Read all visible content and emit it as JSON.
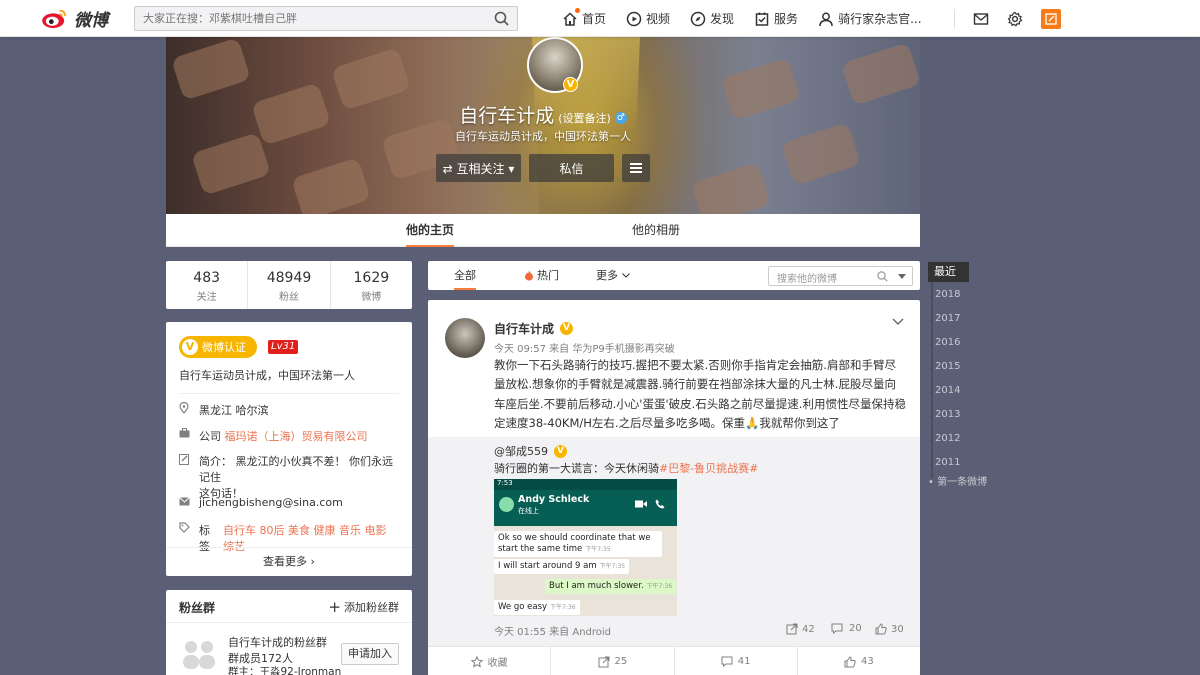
{
  "topbar": {
    "logo_text": "微博",
    "search_placeholder": "大家正在搜：邓紫棋吐槽自己胖",
    "nav": [
      {
        "label": "首页",
        "icon": "home-icon"
      },
      {
        "label": "视频",
        "icon": "video-icon"
      },
      {
        "label": "发现",
        "icon": "discover-icon"
      },
      {
        "label": "服务",
        "icon": "service-icon"
      },
      {
        "label": "骑行家杂志官...",
        "icon": "user-icon"
      }
    ],
    "right_icons": [
      "mail-icon",
      "gear-icon",
      "compose-icon"
    ]
  },
  "profile": {
    "name": "自行车计成",
    "remark": "(设置备注)",
    "gender": "♂",
    "description": "自行车运动员计成，中国环法第一人",
    "follow_button": "⇄ 互相关注 ▾",
    "message_button": "私信",
    "tabs": [
      "他的主页",
      "他的相册"
    ]
  },
  "stats": [
    {
      "num": "483",
      "label": "关注"
    },
    {
      "num": "48949",
      "label": "粉丝"
    },
    {
      "num": "1629",
      "label": "微博"
    }
  ],
  "info": {
    "verify_label": "微博认证",
    "level": "Lv31",
    "desc": "自行车运动员计成，中国环法第一人",
    "location": "黑龙江 哈尔滨",
    "company_prefix": "公司",
    "company": "福玛诺（上海）贸易有限公司",
    "bio_line1": "简介： 黑龙江的小伙真不差！ 你们永远记住",
    "bio_line2": "这句话！",
    "email": "jichengbisheng@sina.com",
    "tags_prefix": "标签",
    "tags": "自行车 80后 美食 健康 音乐 电影 综艺",
    "more": "查看更多 ›"
  },
  "fans_group": {
    "title": "粉丝群",
    "add": "添加粉丝群",
    "group_name": "自行车计成的粉丝群",
    "members": "群成员172人",
    "owner": "群主：王淼92-Ironman",
    "join": "申请加入"
  },
  "feed_tabs": {
    "all": "全部",
    "hot": "热门",
    "more": "更多",
    "search_placeholder": "搜索他的微博"
  },
  "post": {
    "author": "自行车计成",
    "meta": "今天 09:57 来自 华为P9手机摄影再突破",
    "text": "教你一下石头路骑行的技巧.握把不要太紧.否则你手指肯定会抽筋.肩部和手臂尽量放松.想象你的手臂就是减震器.骑行前要在裆部涂抹大量的凡士林.屁股尽量向车座后坐.不要前后移动.小心'蛋蛋'破皮.石头路之前尽量提速.利用惯性尽量保持稳定速度38-40KM/H左右.之后尽量多吃多喝。保重🙏我就帮你到这了",
    "repost": {
      "user": "@邹成559",
      "text_prefix": "骑行圈的第一大谎言：今天休闲骑",
      "text_tag": "#巴黎-鲁贝挑战赛#",
      "chat": {
        "status_time": "7:53",
        "contact": "Andy Schleck",
        "contact_status": "在线上",
        "msg1": "Ok so we should coordinate that we start the same time",
        "msg1_time": "下午7:35",
        "msg2": "I will start around 9 am",
        "msg2_time": "下午7:35",
        "msg3": "But I am much slower.",
        "msg3_time": "下午7:36",
        "msg4": "We go easy",
        "msg4_time": "下午7:36"
      },
      "footer": "今天 01:55 来自 Android",
      "reposts": "42",
      "comments": "20",
      "likes": "30"
    },
    "actions": {
      "collect": "收藏",
      "repost": "25",
      "comment": "41",
      "like": "43"
    }
  },
  "years": {
    "current": "最近",
    "list": [
      "2018",
      "2017",
      "2016",
      "2015",
      "2014",
      "2013",
      "2012",
      "2011"
    ],
    "first": "第一条微博"
  }
}
